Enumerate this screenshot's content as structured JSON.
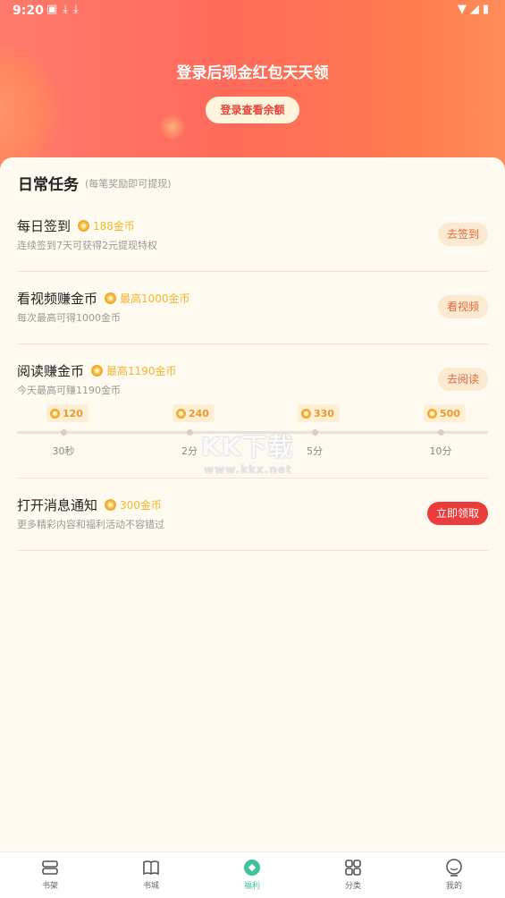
{
  "status_bar": {
    "time": "9:20",
    "left_icons": [
      "photo-icon",
      "download-icon",
      "download-icon"
    ],
    "right_icons": [
      "wifi-icon",
      "signal-icon",
      "battery-icon"
    ]
  },
  "hero": {
    "title": "登录后现金红包天天领",
    "login_button": "登录查看余额"
  },
  "daily": {
    "title": "日常任务",
    "subtitle": "(每笔奖励即可提现)",
    "tasks": [
      {
        "name": "每日签到",
        "reward": "188金币",
        "desc": "连续签到7天可获得2元提现特权",
        "action": "去签到"
      },
      {
        "name": "看视频赚金币",
        "reward": "最高1000金币",
        "desc": "每次最高可得1000金币",
        "action": "看视频"
      },
      {
        "name": "阅读赚金币",
        "reward": "最高1190金币",
        "desc": "今天最高可赚1190金币",
        "action": "去阅读"
      },
      {
        "name": "打开消息通知",
        "reward": "300金币",
        "desc": "更多精彩内容和福利活动不容错过",
        "action": "立即领取"
      }
    ],
    "reading_steps": [
      {
        "coins": "120",
        "time": "30秒"
      },
      {
        "coins": "240",
        "time": "2分"
      },
      {
        "coins": "330",
        "time": "5分"
      },
      {
        "coins": "500",
        "time": "10分"
      }
    ]
  },
  "watermark": {
    "text": "KK下载",
    "url": "www.kkx.net"
  },
  "tabbar": {
    "active": "福利",
    "tabs": [
      {
        "label": "书架",
        "icon": "bookshelf-icon"
      },
      {
        "label": "书城",
        "icon": "book-icon"
      },
      {
        "label": "福利",
        "icon": "welfare-icon"
      },
      {
        "label": "分类",
        "icon": "grid-icon"
      },
      {
        "label": "我的",
        "icon": "profile-icon"
      }
    ]
  },
  "colors": {
    "hero_gradient_start": "#ff7a6c",
    "hero_gradient_end": "#ff8d5a",
    "coin_text": "#f2b531",
    "primary_button": "#ec3b3b",
    "active_tab": "#3ec39a",
    "page_bg": "#fffaf0"
  }
}
